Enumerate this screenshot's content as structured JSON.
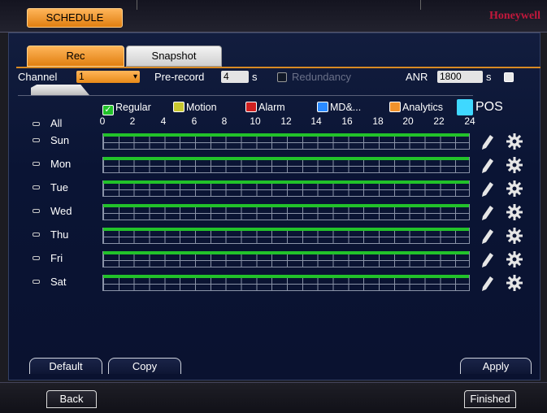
{
  "header": {
    "title": "SCHEDULE",
    "brand": "Honeywell"
  },
  "tabs": [
    {
      "label": "Rec",
      "active": true
    },
    {
      "label": "Snapshot",
      "active": false
    }
  ],
  "settings": {
    "channel_label": "Channel",
    "channel_value": "1",
    "prerecord_label": "Pre-record",
    "prerecord_value": "4",
    "prerecord_unit": "s",
    "redundancy_label": "Redundancy",
    "anr_label": "ANR",
    "anr_value": "1800",
    "anr_unit": "s"
  },
  "legend": [
    {
      "label": "Regular",
      "color": "#22c22a",
      "checked": true
    },
    {
      "label": "Motion",
      "color": "#c8c830"
    },
    {
      "label": "Alarm",
      "color": "#d02020"
    },
    {
      "label": "MD&...",
      "color": "#2a8aff"
    },
    {
      "label": "Analytics",
      "color": "#f0922c"
    },
    {
      "label": "POS",
      "color": "#3fd8ff"
    }
  ],
  "hours": [
    "0",
    "2",
    "4",
    "6",
    "8",
    "10",
    "12",
    "14",
    "16",
    "18",
    "20",
    "22",
    "24"
  ],
  "all_label": "All",
  "days": [
    "Sun",
    "Mon",
    "Tue",
    "Wed",
    "Thu",
    "Fri",
    "Sat"
  ],
  "buttons": {
    "default": "Default",
    "copy": "Copy",
    "apply": "Apply",
    "back": "Back",
    "finished": "Finished"
  }
}
